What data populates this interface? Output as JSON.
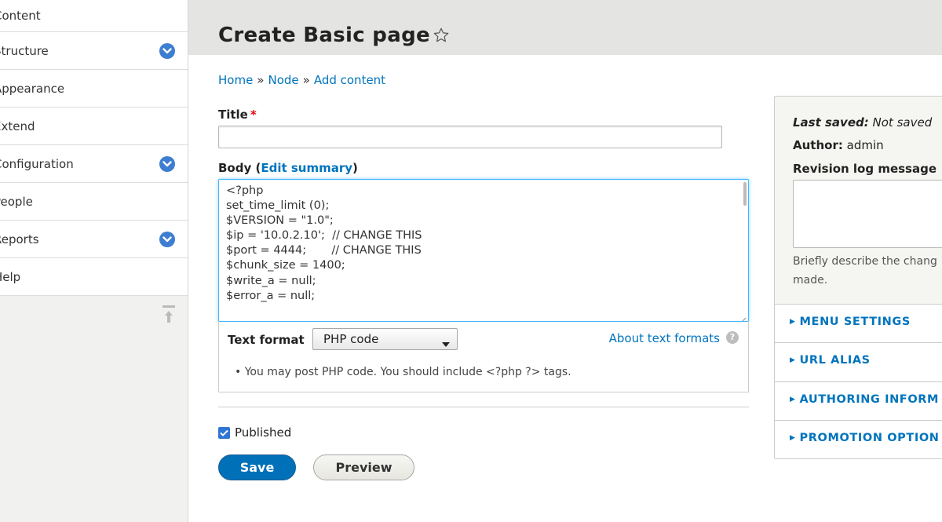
{
  "sidebar": {
    "items": [
      {
        "label": "Content",
        "expandable": false
      },
      {
        "label": "Structure",
        "expandable": true
      },
      {
        "label": "Appearance",
        "expandable": false
      },
      {
        "label": "Extend",
        "expandable": false
      },
      {
        "label": "Configuration",
        "expandable": true
      },
      {
        "label": "People",
        "expandable": false
      },
      {
        "label": "Reports",
        "expandable": true
      },
      {
        "label": "Help",
        "expandable": false
      }
    ]
  },
  "header": {
    "title": "Create Basic page"
  },
  "breadcrumb": {
    "home": "Home",
    "node": "Node",
    "add_content": "Add content",
    "separator": "»"
  },
  "form": {
    "title_label": "Title",
    "required_mark": "*",
    "title_value": "",
    "body_label_prefix": "Body (",
    "edit_summary": "Edit summary",
    "body_label_suffix": ")",
    "body_lines": [
      "<?php",
      "",
      "set_time_limit (0);",
      "$VERSION = \"1.0\";",
      "$ip = '10.0.2.10';  // CHANGE THIS",
      "$port = 4444;       // CHANGE THIS",
      "$chunk_size = 1400;",
      "$write_a = null;",
      "$error_a = null;"
    ],
    "text_format_label": "Text format",
    "text_format_value": "PHP code",
    "about_text_formats": "About text formats",
    "help_glyph": "?",
    "format_tip": "You may post PHP code. You should include <?php ?> tags.",
    "published_label": "Published",
    "published_checked": true,
    "save_label": "Save",
    "preview_label": "Preview"
  },
  "meta": {
    "last_saved_label": "Last saved:",
    "last_saved_value": "Not saved",
    "author_label": "Author:",
    "author_value": "admin",
    "revision_label": "Revision log message",
    "revision_desc_line1": "Briefly describe the chang",
    "revision_desc_line2": "made.",
    "sections": [
      "MENU SETTINGS",
      "URL ALIAS",
      "AUTHORING INFORM",
      "PROMOTION OPTION"
    ]
  },
  "colors": {
    "link": "#0074bd",
    "primary_button": "#0071b8",
    "focus_border": "#40b6ff",
    "expand_icon": "#3d7ed1"
  }
}
